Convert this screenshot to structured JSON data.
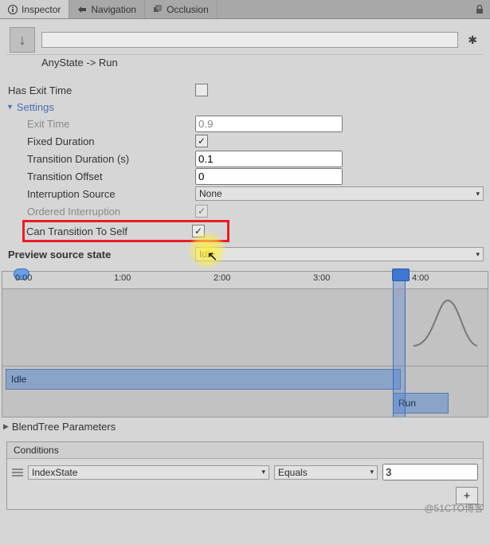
{
  "tabs": {
    "inspector": "Inspector",
    "navigation": "Navigation",
    "occlusion": "Occlusion"
  },
  "header": {
    "name_field": "",
    "subtitle": "AnyState -> Run"
  },
  "props": {
    "has_exit_time": {
      "label": "Has Exit Time",
      "checked": false
    },
    "settings_label": "Settings",
    "exit_time": {
      "label": "Exit Time",
      "value": "0.9"
    },
    "fixed_duration": {
      "label": "Fixed Duration",
      "checked": true
    },
    "transition_duration": {
      "label": "Transition Duration (s)",
      "value": "0.1"
    },
    "transition_offset": {
      "label": "Transition Offset",
      "value": "0"
    },
    "interruption_source": {
      "label": "Interruption Source",
      "value": "None"
    },
    "ordered_interruption": {
      "label": "Ordered Interruption",
      "checked": true
    },
    "can_transition_to_self": {
      "label": "Can Transition To Self",
      "checked": true
    },
    "preview_source_state": {
      "label": "Preview source state",
      "value": "Idle"
    }
  },
  "timeline": {
    "ticks": [
      "0:00",
      "1:00",
      "2:00",
      "3:00",
      "4:00"
    ],
    "clips": {
      "idle": "Idle",
      "run": "Run"
    }
  },
  "blendtree_label": "BlendTree Parameters",
  "conditions": {
    "header": "Conditions",
    "param": "IndexState",
    "comparator": "Equals",
    "value": "3",
    "add": "+"
  },
  "watermark": "@51CTO博客"
}
